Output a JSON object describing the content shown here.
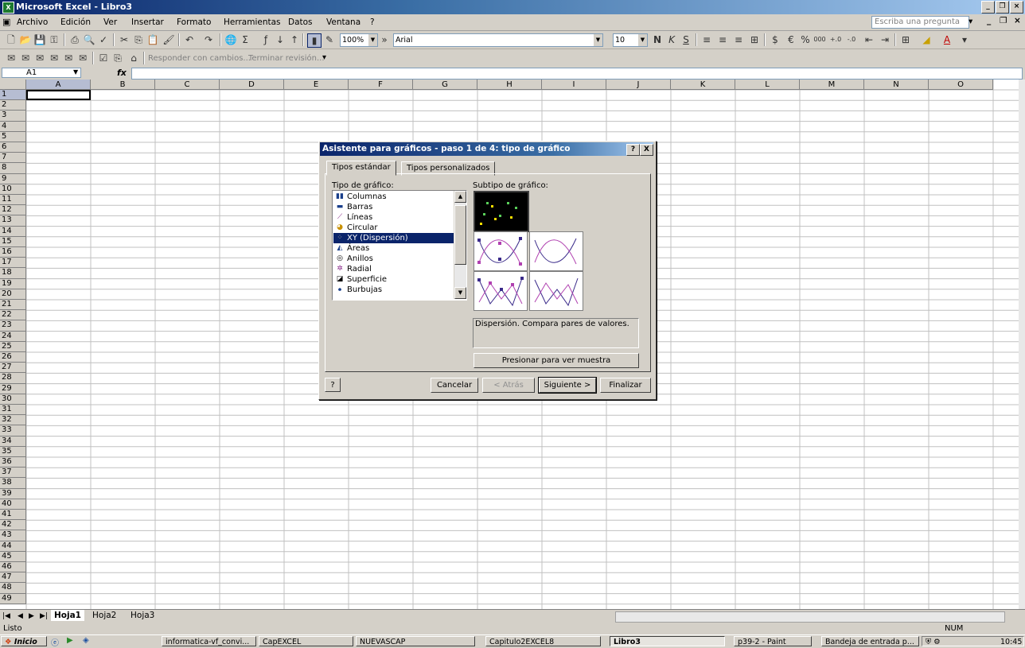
{
  "window": {
    "title": "Microsoft Excel - Libro3",
    "app_icon": "excel-icon"
  },
  "menu": [
    "Archivo",
    "Edición",
    "Ver",
    "Insertar",
    "Formato",
    "Herramientas",
    "Datos",
    "Ventana",
    "?"
  ],
  "ask_question": "Escriba una pregunta",
  "toolbar": {
    "zoom": "100%",
    "font": "Arial",
    "size": "10",
    "review_reply": "Responder con cambios...",
    "review_end": "Terminar revisión..."
  },
  "formula_bar": {
    "cell_ref": "A1",
    "fx": "fx",
    "value": ""
  },
  "columns": [
    "A",
    "B",
    "C",
    "D",
    "E",
    "F",
    "G",
    "H",
    "I",
    "J",
    "K",
    "L",
    "M",
    "N",
    "O"
  ],
  "rows": [
    "1",
    "2",
    "3",
    "4",
    "5",
    "6",
    "7",
    "8",
    "9",
    "10",
    "11",
    "12",
    "13",
    "14",
    "15",
    "16",
    "17",
    "18",
    "19",
    "20",
    "21",
    "22",
    "23",
    "24",
    "25",
    "26",
    "27",
    "28",
    "29",
    "30",
    "31",
    "32",
    "33",
    "34",
    "35",
    "36",
    "37",
    "38",
    "39",
    "40",
    "41",
    "42",
    "43",
    "44",
    "45",
    "46",
    "47",
    "48",
    "49"
  ],
  "sheets": {
    "tabs": [
      "Hoja1",
      "Hoja2",
      "Hoja3"
    ],
    "active": "Hoja1"
  },
  "status": {
    "left": "Listo",
    "num": "NUM"
  },
  "dialog": {
    "title": "Asistente para gráficos - paso 1 de 4: tipo de gráfico",
    "help_btn": "?",
    "close_btn": "X",
    "tabs": [
      "Tipos estándar",
      "Tipos personalizados"
    ],
    "type_label": "Tipo de gráfico:",
    "subtype_label": "Subtipo de gráfico:",
    "chart_types": [
      "Columnas",
      "Barras",
      "Líneas",
      "Circular",
      "XY (Dispersión)",
      "Áreas",
      "Anillos",
      "Radial",
      "Superficie",
      "Burbujas"
    ],
    "selected_type": "XY (Dispersión)",
    "description": "Dispersión. Compara pares de valores.",
    "preview_button": "Presionar para ver muestra",
    "buttons": {
      "cancel": "Cancelar",
      "back": "< Atrás",
      "next": "Siguiente >",
      "finish": "Finalizar"
    }
  },
  "taskbar": {
    "start": "Inicio",
    "tasks": [
      "informatica-vf_convi...",
      "CapEXCEL",
      "NUEVASCAP",
      "Capitulo2EXCEL8",
      "Libro3",
      "p39-2 - Paint",
      "Bandeja de entrada p..."
    ],
    "clock": "10:45"
  }
}
